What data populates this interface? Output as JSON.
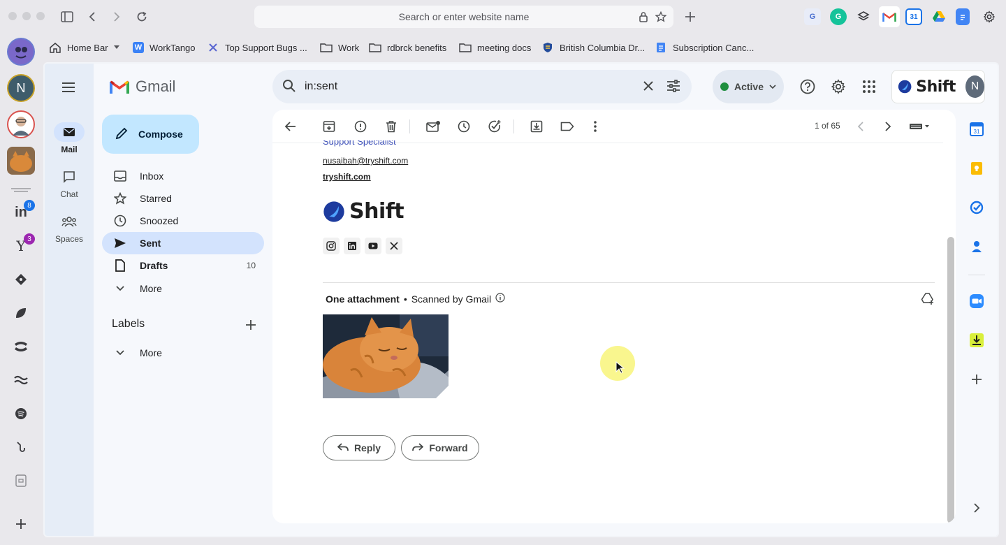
{
  "browser": {
    "url_placeholder": "Search or enter website name",
    "bookmarks": [
      {
        "label": "Home Bar",
        "icon": "home-icon"
      },
      {
        "label": "WorkTango",
        "icon": "worktango-icon"
      },
      {
        "label": "Top Support Bugs ...",
        "icon": "x-linear-icon"
      },
      {
        "label": "Work",
        "icon": "folder-icon"
      },
      {
        "label": "rdbrck benefits",
        "icon": "folder-icon"
      },
      {
        "label": "meeting docs",
        "icon": "folder-icon"
      },
      {
        "label": "British Columbia Dr...",
        "icon": "shield-icon"
      },
      {
        "label": "Subscription Canc...",
        "icon": "docs-icon"
      }
    ]
  },
  "dock": {
    "profile_initial": "N",
    "linkedin_badge": "8",
    "yahoo_badge": "3"
  },
  "gmail": {
    "app_name": "Gmail",
    "compose_label": "Compose",
    "rail": [
      {
        "label": "Mail"
      },
      {
        "label": "Chat"
      },
      {
        "label": "Spaces"
      }
    ],
    "nav": [
      {
        "label": "Inbox",
        "count": ""
      },
      {
        "label": "Starred",
        "count": ""
      },
      {
        "label": "Snoozed",
        "count": ""
      },
      {
        "label": "Sent",
        "count": ""
      },
      {
        "label": "Drafts",
        "count": "10"
      },
      {
        "label": "More",
        "count": ""
      }
    ],
    "labels_title": "Labels",
    "labels_more": "More",
    "search_query": "in:sent",
    "status_label": "Active",
    "account_brand": "Shift",
    "account_initial": "N",
    "pager": "1 of 65"
  },
  "email": {
    "signature_title": "Support Specialist",
    "signature_email": "nusaibah@tryshift.com",
    "signature_site": "tryshift.com",
    "signature_brand": "Shift",
    "attachment_count": "One attachment",
    "scanned_text": "Scanned by Gmail",
    "reply_label": "Reply",
    "forward_label": "Forward"
  },
  "colors": {
    "accent": "#0b57d0",
    "compose_bg": "#c2e7ff",
    "active_nav": "#d3e3fd",
    "status_green": "#1e8e3e"
  }
}
